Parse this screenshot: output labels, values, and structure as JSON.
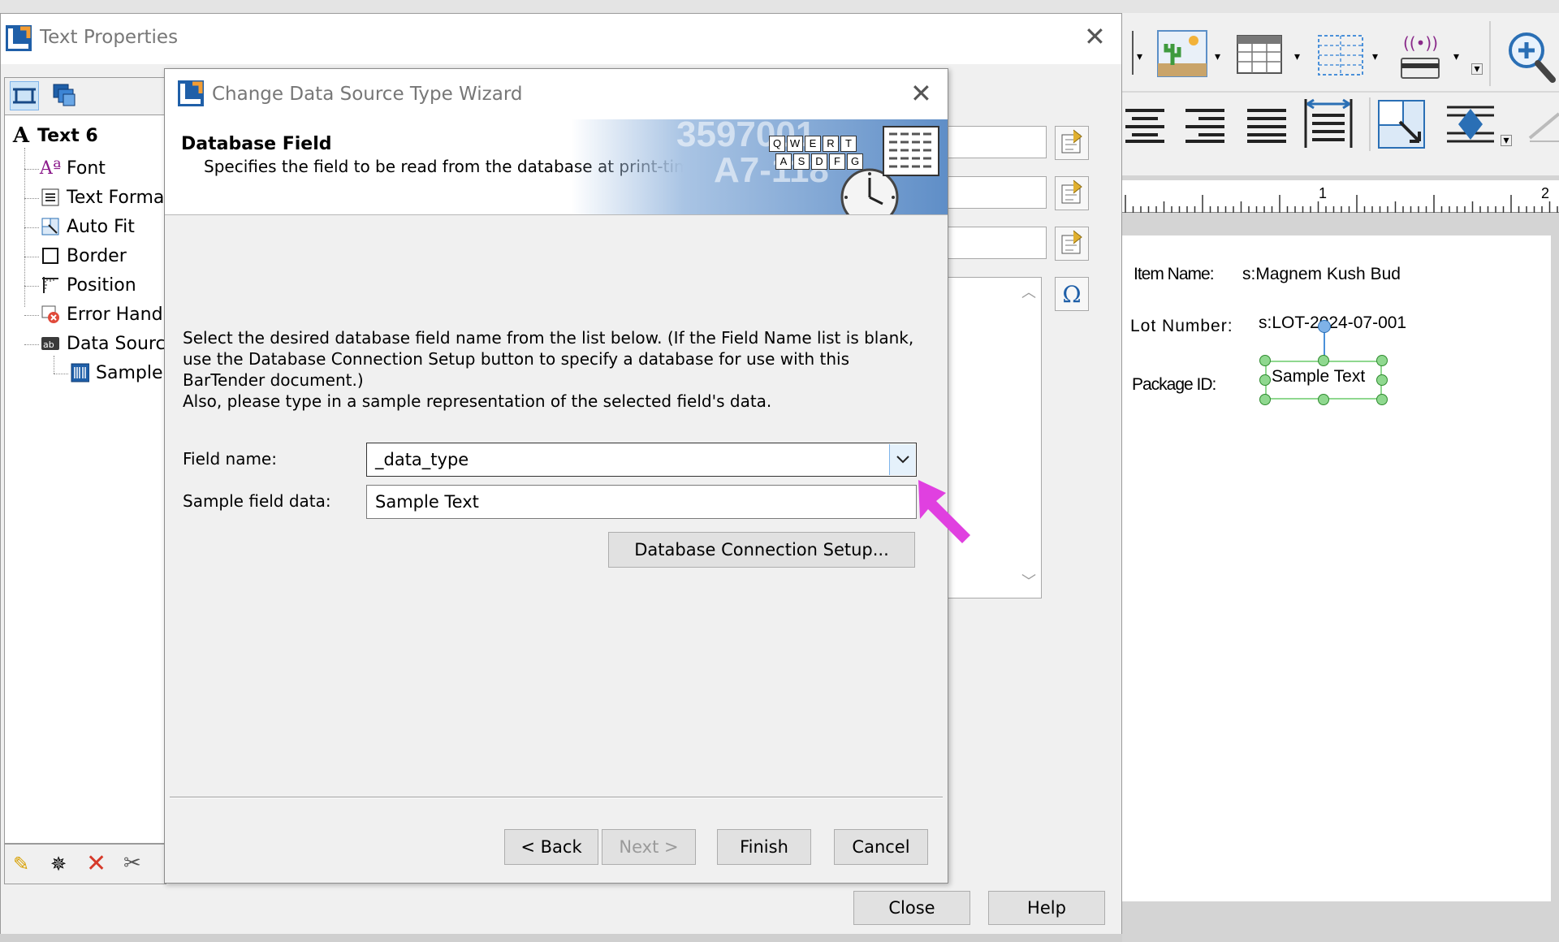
{
  "outer_dialog": {
    "title": "Text Properties",
    "close_button": "Close",
    "help_button": "Help"
  },
  "tree": {
    "root": "Text 6",
    "items": [
      {
        "label": "Font",
        "icon": "font-icon"
      },
      {
        "label": "Text Format",
        "icon": "text-format-icon"
      },
      {
        "label": "Auto Fit",
        "icon": "auto-fit-icon"
      },
      {
        "label": "Border",
        "icon": "border-icon"
      },
      {
        "label": "Position",
        "icon": "position-icon"
      },
      {
        "label": "Error Handling",
        "icon": "error-handling-icon"
      },
      {
        "label": "Data Source",
        "icon": "data-source-icon"
      },
      {
        "label": "Sample",
        "icon": "database-icon"
      }
    ]
  },
  "wizard": {
    "title": "Change Data Source Type Wizard",
    "header_title": "Database Field",
    "header_subtitle": "Specifies the field to be read from the database at print-time.",
    "banner_text_1": "3597001",
    "banner_text_2": "A7-118",
    "instructions_1": "Select the desired database field name from the list below. (If the Field Name list is blank, use the Database Connection Setup button to specify a database for use with this BarTender document.)",
    "instructions_2": "Also, please type in a sample representation of the selected field's data.",
    "field_name_label": "Field name:",
    "field_name_value": "_data_type",
    "sample_label": "Sample field data:",
    "sample_value": "Sample Text",
    "db_setup_button": "Database Connection Setup...",
    "back_button": "< Back",
    "next_button": "Next >",
    "finish_button": "Finish",
    "cancel_button": "Cancel",
    "keyboard_keys_row1": [
      "Q",
      "W",
      "E",
      "R",
      "T"
    ],
    "keyboard_keys_row2": [
      "A",
      "S",
      "D",
      "F",
      "G"
    ]
  },
  "design": {
    "item_name_label": "Item Name:",
    "item_name_value": "s:Magnem Kush Bud",
    "lot_label": "Lot Number:",
    "lot_value": "s:LOT-2024-07-001",
    "package_label": "Package ID:",
    "package_value": "Sample Text",
    "ruler_1": "1",
    "ruler_2": "2"
  },
  "colors": {
    "accent_blue": "#1f5fa8",
    "arrow_magenta": "#e040e0",
    "selection_green": "#2e8b2e"
  }
}
